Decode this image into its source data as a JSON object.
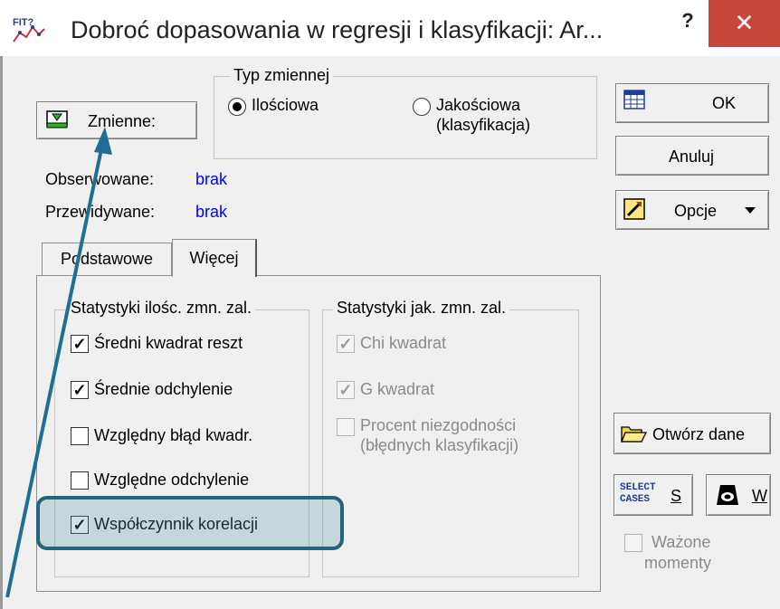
{
  "window": {
    "title": "Dobroć dopasowania w regresji i klasyfikacji: Ar...",
    "icon_label": "FIT?",
    "help_label": "?",
    "close_label": "✕"
  },
  "buttons": {
    "variables_label": "Zmienne:",
    "ok_label": "OK",
    "cancel_label": "Anuluj",
    "options_label": "Opcje",
    "open_data_label": "Otwórz dane",
    "select_cases_icon_text": "SELECT CASES",
    "select_cases_label": "S",
    "weights_label": "W"
  },
  "variable_type": {
    "legend": "Typ zmiennej",
    "options": [
      {
        "label": "Ilościowa",
        "selected": true
      },
      {
        "label_line1": "Jakościowa",
        "label_line2": "(klasyfikacja)",
        "selected": false
      }
    ]
  },
  "info": {
    "observed_label": "Obserwowane:",
    "observed_value": "brak",
    "predicted_label": "Przewidywane:",
    "predicted_value": "brak"
  },
  "tabs": [
    {
      "label": "Podstawowe",
      "active": false
    },
    {
      "label": "Więcej",
      "active": true
    }
  ],
  "quant_group": {
    "legend": "Statystyki ilośc. zmn. zal.",
    "items": [
      {
        "label": "Średni kwadrat reszt",
        "checked": true
      },
      {
        "label": "Średnie odchylenie",
        "checked": true
      },
      {
        "label": "Względny błąd kwadr.",
        "checked": false
      },
      {
        "label": "Względne odchylenie",
        "checked": false
      },
      {
        "label": "Współczynnik korelacji",
        "checked": true
      }
    ]
  },
  "qual_group": {
    "legend": "Statystyki jak. zmn. zal.",
    "items": [
      {
        "label": "Chi kwadrat",
        "checked": true
      },
      {
        "label": "G kwadrat",
        "checked": true
      },
      {
        "label_line1": "Procent niezgodności",
        "label_line2": "(błędnych klasyfikacji)",
        "checked": false
      }
    ]
  },
  "weighted": {
    "label_line1": "Ważone",
    "label_line2": "momenty",
    "checked": false
  },
  "colors": {
    "accent_annotation": "#24637d",
    "close_button": "#c9463d",
    "value_blue": "#0000ff"
  }
}
